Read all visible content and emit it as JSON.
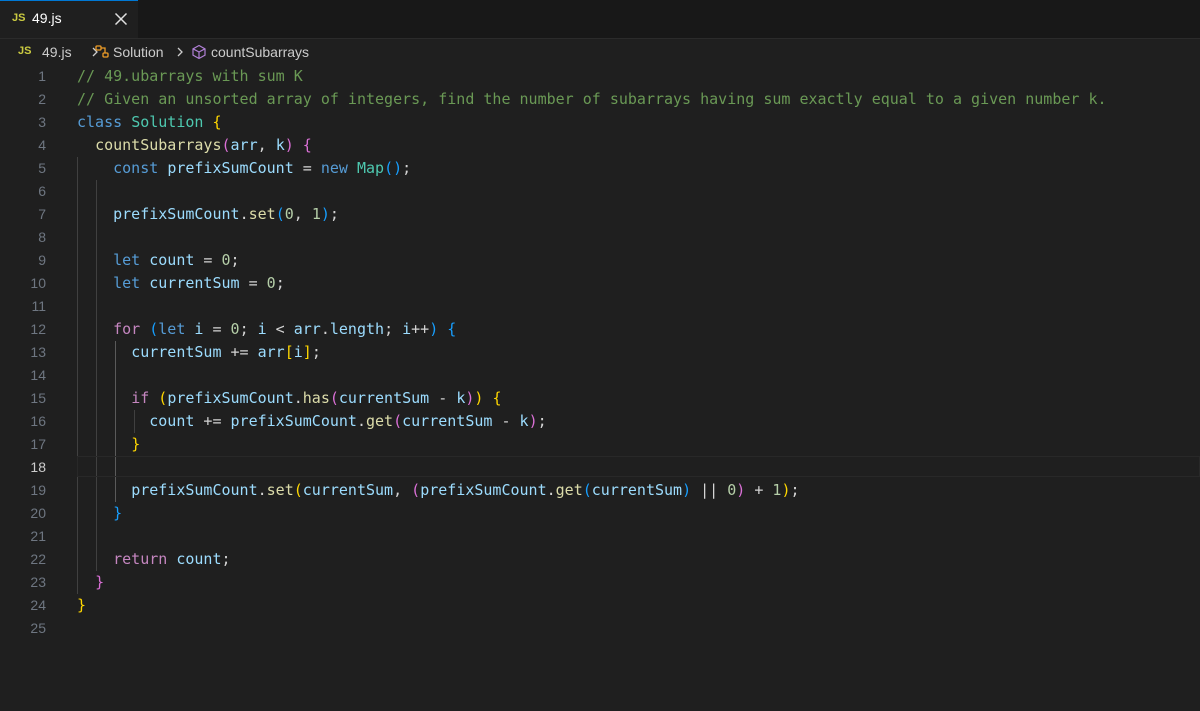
{
  "tab": {
    "badge": "JS",
    "name": "49.js"
  },
  "breadcrumb": {
    "badge": "JS",
    "file": "49.js",
    "class_name": "Solution",
    "method_name": "countSubarrays"
  },
  "editor": {
    "active_line": 18,
    "lines": [
      {
        "n": "1",
        "tokens": [
          {
            "c": "c",
            "t": "// 49.ubarrays with sum K"
          }
        ]
      },
      {
        "n": "2",
        "tokens": [
          {
            "c": "c",
            "t": "// Given an unsorted array of integers, find the number of subarrays having sum exactly equal to a given number k."
          }
        ]
      },
      {
        "n": "3",
        "tokens": [
          {
            "c": "k",
            "t": "class "
          },
          {
            "c": "t",
            "t": "Solution"
          },
          {
            "c": "p",
            "t": " "
          },
          {
            "c": "b1",
            "t": "{"
          }
        ]
      },
      {
        "n": "4",
        "tokens": [
          {
            "c": "p",
            "t": "  "
          },
          {
            "c": "f",
            "t": "countSubarrays"
          },
          {
            "c": "b2",
            "t": "("
          },
          {
            "c": "v",
            "t": "arr"
          },
          {
            "c": "p",
            "t": ", "
          },
          {
            "c": "v",
            "t": "k"
          },
          {
            "c": "b2",
            "t": ")"
          },
          {
            "c": "p",
            "t": " "
          },
          {
            "c": "b2",
            "t": "{"
          }
        ]
      },
      {
        "n": "5",
        "tokens": [
          {
            "c": "p",
            "t": "    "
          },
          {
            "c": "k",
            "t": "const "
          },
          {
            "c": "v",
            "t": "prefixSumCount"
          },
          {
            "c": "p",
            "t": " = "
          },
          {
            "c": "k",
            "t": "new "
          },
          {
            "c": "t",
            "t": "Map"
          },
          {
            "c": "b3",
            "t": "()"
          },
          {
            "c": "p",
            "t": ";"
          }
        ]
      },
      {
        "n": "6",
        "tokens": []
      },
      {
        "n": "7",
        "tokens": [
          {
            "c": "p",
            "t": "    "
          },
          {
            "c": "v",
            "t": "prefixSumCount"
          },
          {
            "c": "p",
            "t": "."
          },
          {
            "c": "f",
            "t": "set"
          },
          {
            "c": "b3",
            "t": "("
          },
          {
            "c": "n",
            "t": "0"
          },
          {
            "c": "p",
            "t": ", "
          },
          {
            "c": "n",
            "t": "1"
          },
          {
            "c": "b3",
            "t": ")"
          },
          {
            "c": "p",
            "t": ";"
          }
        ]
      },
      {
        "n": "8",
        "tokens": []
      },
      {
        "n": "9",
        "tokens": [
          {
            "c": "p",
            "t": "    "
          },
          {
            "c": "k",
            "t": "let "
          },
          {
            "c": "v",
            "t": "count"
          },
          {
            "c": "p",
            "t": " = "
          },
          {
            "c": "n",
            "t": "0"
          },
          {
            "c": "p",
            "t": ";"
          }
        ]
      },
      {
        "n": "10",
        "tokens": [
          {
            "c": "p",
            "t": "    "
          },
          {
            "c": "k",
            "t": "let "
          },
          {
            "c": "v",
            "t": "currentSum"
          },
          {
            "c": "p",
            "t": " = "
          },
          {
            "c": "n",
            "t": "0"
          },
          {
            "c": "p",
            "t": ";"
          }
        ]
      },
      {
        "n": "11",
        "tokens": []
      },
      {
        "n": "12",
        "tokens": [
          {
            "c": "p",
            "t": "    "
          },
          {
            "c": "ctl",
            "t": "for"
          },
          {
            "c": "p",
            "t": " "
          },
          {
            "c": "b3",
            "t": "("
          },
          {
            "c": "k",
            "t": "let "
          },
          {
            "c": "v",
            "t": "i"
          },
          {
            "c": "p",
            "t": " = "
          },
          {
            "c": "n",
            "t": "0"
          },
          {
            "c": "p",
            "t": "; "
          },
          {
            "c": "v",
            "t": "i"
          },
          {
            "c": "p",
            "t": " < "
          },
          {
            "c": "v",
            "t": "arr"
          },
          {
            "c": "p",
            "t": "."
          },
          {
            "c": "v",
            "t": "length"
          },
          {
            "c": "p",
            "t": "; "
          },
          {
            "c": "v",
            "t": "i"
          },
          {
            "c": "p",
            "t": "++"
          },
          {
            "c": "b3",
            "t": ")"
          },
          {
            "c": "p",
            "t": " "
          },
          {
            "c": "b3",
            "t": "{"
          }
        ]
      },
      {
        "n": "13",
        "tokens": [
          {
            "c": "p",
            "t": "      "
          },
          {
            "c": "v",
            "t": "currentSum"
          },
          {
            "c": "p",
            "t": " += "
          },
          {
            "c": "v",
            "t": "arr"
          },
          {
            "c": "b1",
            "t": "["
          },
          {
            "c": "v",
            "t": "i"
          },
          {
            "c": "b1",
            "t": "]"
          },
          {
            "c": "p",
            "t": ";"
          }
        ]
      },
      {
        "n": "14",
        "tokens": []
      },
      {
        "n": "15",
        "tokens": [
          {
            "c": "p",
            "t": "      "
          },
          {
            "c": "ctl",
            "t": "if"
          },
          {
            "c": "p",
            "t": " "
          },
          {
            "c": "b1",
            "t": "("
          },
          {
            "c": "v",
            "t": "prefixSumCount"
          },
          {
            "c": "p",
            "t": "."
          },
          {
            "c": "f",
            "t": "has"
          },
          {
            "c": "b2",
            "t": "("
          },
          {
            "c": "v",
            "t": "currentSum"
          },
          {
            "c": "p",
            "t": " - "
          },
          {
            "c": "v",
            "t": "k"
          },
          {
            "c": "b2",
            "t": ")"
          },
          {
            "c": "b1",
            "t": ")"
          },
          {
            "c": "p",
            "t": " "
          },
          {
            "c": "b1",
            "t": "{"
          }
        ]
      },
      {
        "n": "16",
        "tokens": [
          {
            "c": "p",
            "t": "        "
          },
          {
            "c": "v",
            "t": "count"
          },
          {
            "c": "p",
            "t": " += "
          },
          {
            "c": "v",
            "t": "prefixSumCount"
          },
          {
            "c": "p",
            "t": "."
          },
          {
            "c": "f",
            "t": "get"
          },
          {
            "c": "b2",
            "t": "("
          },
          {
            "c": "v",
            "t": "currentSum"
          },
          {
            "c": "p",
            "t": " - "
          },
          {
            "c": "v",
            "t": "k"
          },
          {
            "c": "b2",
            "t": ")"
          },
          {
            "c": "p",
            "t": ";"
          }
        ]
      },
      {
        "n": "17",
        "tokens": [
          {
            "c": "p",
            "t": "      "
          },
          {
            "c": "b1",
            "t": "}"
          }
        ]
      },
      {
        "n": "18",
        "tokens": []
      },
      {
        "n": "19",
        "tokens": [
          {
            "c": "p",
            "t": "      "
          },
          {
            "c": "v",
            "t": "prefixSumCount"
          },
          {
            "c": "p",
            "t": "."
          },
          {
            "c": "f",
            "t": "set"
          },
          {
            "c": "b1",
            "t": "("
          },
          {
            "c": "v",
            "t": "currentSum"
          },
          {
            "c": "p",
            "t": ", "
          },
          {
            "c": "b2",
            "t": "("
          },
          {
            "c": "v",
            "t": "prefixSumCount"
          },
          {
            "c": "p",
            "t": "."
          },
          {
            "c": "f",
            "t": "get"
          },
          {
            "c": "b3",
            "t": "("
          },
          {
            "c": "v",
            "t": "currentSum"
          },
          {
            "c": "b3",
            "t": ")"
          },
          {
            "c": "p",
            "t": " || "
          },
          {
            "c": "n",
            "t": "0"
          },
          {
            "c": "b2",
            "t": ")"
          },
          {
            "c": "p",
            "t": " + "
          },
          {
            "c": "n",
            "t": "1"
          },
          {
            "c": "b1",
            "t": ")"
          },
          {
            "c": "p",
            "t": ";"
          }
        ]
      },
      {
        "n": "20",
        "tokens": [
          {
            "c": "p",
            "t": "    "
          },
          {
            "c": "b3",
            "t": "}"
          }
        ]
      },
      {
        "n": "21",
        "tokens": []
      },
      {
        "n": "22",
        "tokens": [
          {
            "c": "p",
            "t": "    "
          },
          {
            "c": "ctl",
            "t": "return"
          },
          {
            "c": "p",
            "t": " "
          },
          {
            "c": "v",
            "t": "count"
          },
          {
            "c": "p",
            "t": ";"
          }
        ]
      },
      {
        "n": "23",
        "tokens": [
          {
            "c": "p",
            "t": "  "
          },
          {
            "c": "b2",
            "t": "}"
          }
        ]
      },
      {
        "n": "24",
        "tokens": [
          {
            "c": "b1",
            "t": "}"
          }
        ]
      },
      {
        "n": "25",
        "tokens": []
      }
    ]
  }
}
